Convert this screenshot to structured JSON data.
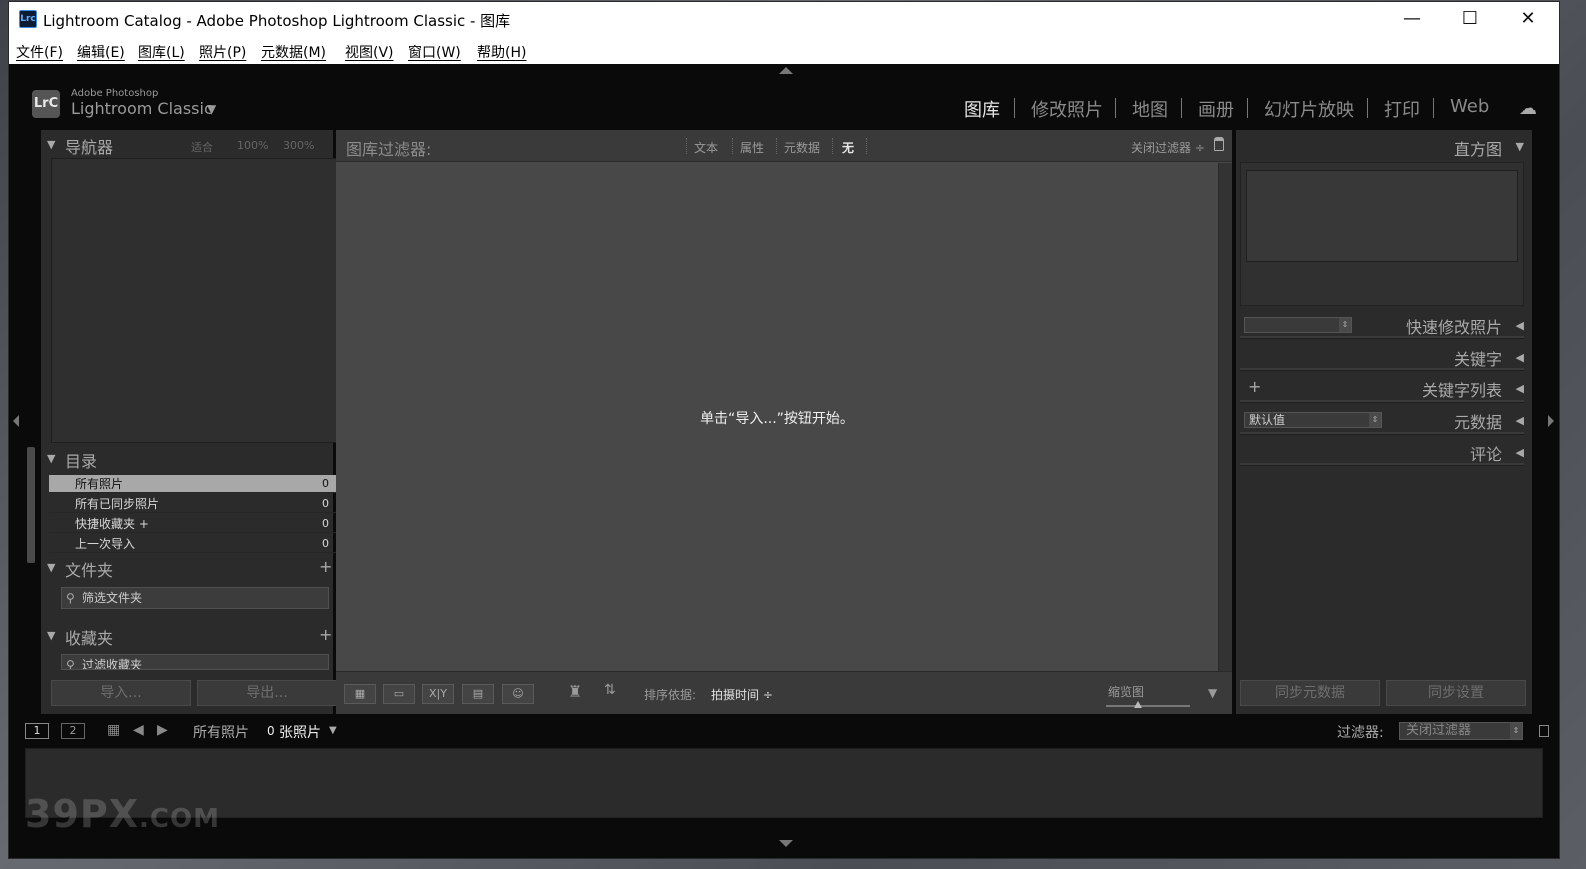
{
  "window": {
    "title": "Lightroom Catalog - Adobe Photoshop Lightroom Classic - 图库",
    "app_icon": "Lrc",
    "controls": {
      "minimize": "—",
      "maximize": "☐",
      "close": "✕"
    }
  },
  "menu": [
    "文件(F)",
    "编辑(E)",
    "图库(L)",
    "照片(P)",
    "元数据(M)",
    "视图(V)",
    "窗口(W)",
    "帮助(H)"
  ],
  "identity": {
    "logo": "LrC",
    "small": "Adobe Photoshop",
    "big": "Lightroom Classic"
  },
  "modules": [
    "图库",
    "修改照片",
    "地图",
    "画册",
    "幻灯片放映",
    "打印",
    "Web"
  ],
  "active_module": "图库",
  "left_panel": {
    "navigator": {
      "title": "导航器",
      "zoom": [
        "适合",
        "100%",
        "300%"
      ]
    },
    "catalog": {
      "title": "目录",
      "items": [
        {
          "label": "所有照片",
          "count": "0"
        },
        {
          "label": "所有已同步照片",
          "count": "0"
        },
        {
          "label": "快捷收藏夹 +",
          "count": "0"
        },
        {
          "label": "上一次导入",
          "count": "0"
        }
      ]
    },
    "folders": {
      "title": "文件夹",
      "search": "筛选文件夹"
    },
    "collections": {
      "title": "收藏夹",
      "search": "过滤收藏夹"
    },
    "import_button": "导入...",
    "export_button": "导出..."
  },
  "filter_bar": {
    "label": "图库过滤器:",
    "options": [
      "文本",
      "属性",
      "元数据",
      "无"
    ],
    "active": "无",
    "preset": "关闭过滤器 ÷"
  },
  "grid": {
    "empty_message": "单击“导入...”按钮开始。"
  },
  "toolbar": {
    "view_buttons": [
      "grid",
      "loupe",
      "compare",
      "survey",
      "people"
    ],
    "compare_label": "X|Y",
    "sort_label": "排序依据:",
    "sort_value": "拍摄时间 ÷",
    "thumb_label": "缩览图"
  },
  "right_panel": {
    "histogram": "直方图",
    "quick_develop": "快速修改照片",
    "keywording": "关键字",
    "keyword_list": "关键字列表",
    "metadata": "元数据",
    "metadata_preset": "默认值",
    "comments": "评论",
    "sync_metadata": "同步元数据",
    "sync_settings": "同步设置"
  },
  "filmstrip": {
    "page1": "1",
    "page2": "2",
    "source": "所有照片",
    "count": "0",
    "count_suffix": "张照片",
    "filter_label": "过滤器:",
    "filter_value": "关闭过滤器"
  },
  "watermark": {
    "main": "39PX",
    "suffix": ".COM"
  }
}
